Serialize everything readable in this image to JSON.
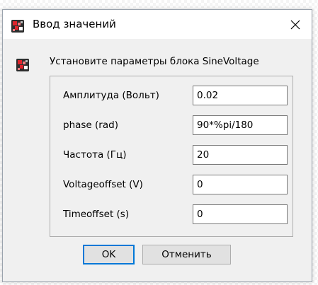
{
  "dialog": {
    "title": "Ввод значений",
    "close_icon": "close-icon",
    "app_icon": "scilab-block-icon"
  },
  "prompt": "Установите параметры блока SineVoltage",
  "fields": [
    {
      "label": "Амплитуда (Вольт)",
      "value": "0.02"
    },
    {
      "label": "phase (rad)",
      "value": "90*%pi/180"
    },
    {
      "label": "Частота (Гц)",
      "value": "20"
    },
    {
      "label": "Voltageoffset (V)",
      "value": "0"
    },
    {
      "label": "Timeoffset (s)",
      "value": "0"
    }
  ],
  "buttons": {
    "ok": "OK",
    "cancel": "Отменить"
  },
  "colors": {
    "focus_border": "#0078d7",
    "dialog_bg": "#f0f0f0",
    "icon_red": "#e0242c"
  }
}
